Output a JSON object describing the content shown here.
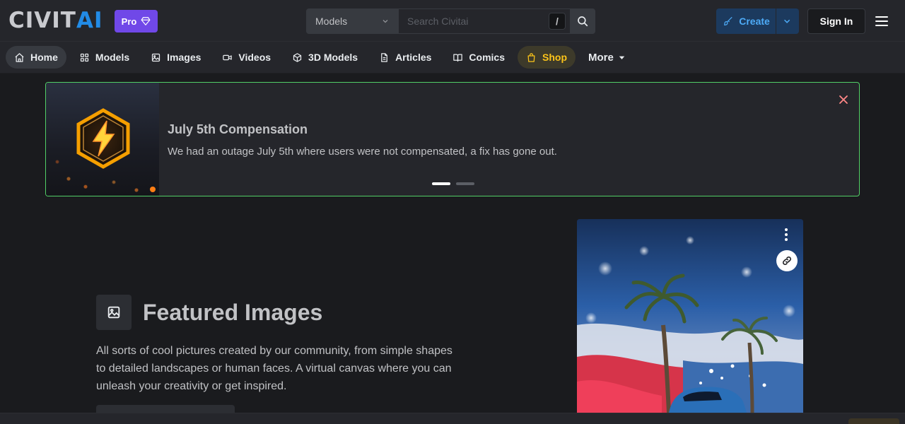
{
  "header": {
    "logo_main": "CIVIT",
    "logo_accent": "AI",
    "pro_label": "Pro",
    "search": {
      "type_selected": "Models",
      "placeholder": "Search Civitai",
      "shortcut": "/"
    },
    "create_label": "Create",
    "signin_label": "Sign In"
  },
  "nav": {
    "items": [
      {
        "label": "Home",
        "icon": "home-icon"
      },
      {
        "label": "Models",
        "icon": "grid-icon"
      },
      {
        "label": "Images",
        "icon": "image-icon"
      },
      {
        "label": "Videos",
        "icon": "video-icon"
      },
      {
        "label": "3D Models",
        "icon": "cube-icon"
      },
      {
        "label": "Articles",
        "icon": "file-text-icon"
      },
      {
        "label": "Comics",
        "icon": "book-icon"
      },
      {
        "label": "Shop",
        "icon": "shopping-bag-icon"
      },
      {
        "label": "More",
        "icon": "caret-down-icon"
      }
    ],
    "active": "Home"
  },
  "announcement": {
    "title": "July 5th Compensation",
    "text": "We had an outage July 5th where users were not compensated, a fix has gone out.",
    "page_count": 2,
    "current_page": 1
  },
  "featured": {
    "title": "Featured Images",
    "description": "All sorts of cool pictures created by our community, from simple shapes to detailed landscapes or human faces. A virtual canvas where you can unleash your creativity or get inspired."
  },
  "colors": {
    "brand_blue": "#228be6",
    "pro_purple": "#7048e8",
    "shop_yellow": "#fcc419",
    "banner_border": "#51cf66",
    "close_red": "#ff8787"
  }
}
